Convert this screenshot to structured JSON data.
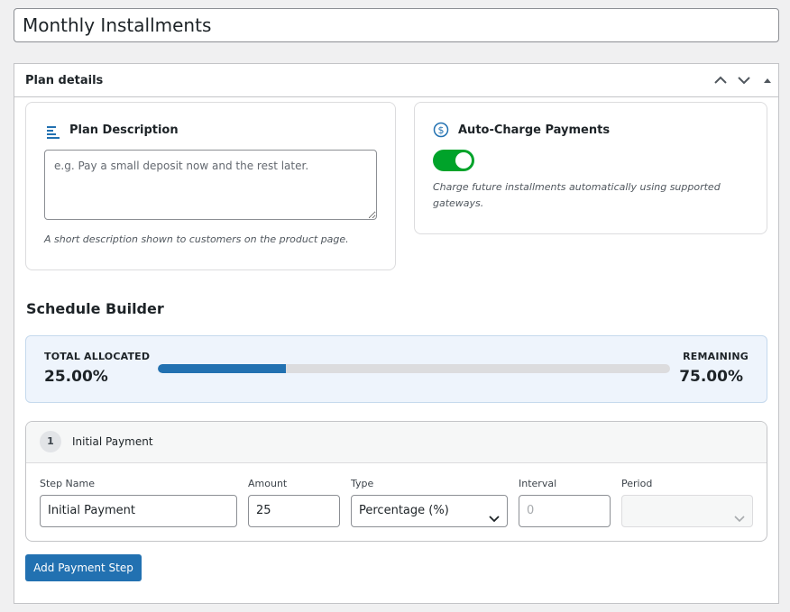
{
  "post_title": "Monthly Installments",
  "metabox": {
    "title": "Plan details",
    "icons": [
      "chevron-up-icon",
      "chevron-down-icon",
      "collapse-triangle-icon"
    ]
  },
  "plan_description": {
    "title": "Plan Description",
    "icon": "text-lines-icon",
    "placeholder": "e.g. Pay a small deposit now and the rest later.",
    "value": "",
    "help": "A short description shown to customers on the product page."
  },
  "auto_charge": {
    "title": "Auto-Charge Payments",
    "icon": "dollar-circle-icon",
    "enabled": true,
    "help": "Charge future installments automatically using supported gateways."
  },
  "schedule": {
    "title": "Schedule Builder",
    "total_label": "TOTAL ALLOCATED",
    "total_value": "25.00%",
    "remaining_label": "REMAINING",
    "remaining_value": "75.00%",
    "allocated_fraction": 0.25,
    "colors": {
      "bar_fill": "#2271b1",
      "toggle_on": "#00a32a"
    }
  },
  "steps": [
    {
      "number": "1",
      "header_name": "Initial Payment",
      "fields": {
        "step_name_label": "Step Name",
        "step_name_value": "Initial Payment",
        "amount_label": "Amount",
        "amount_value": "25",
        "type_label": "Type",
        "type_value": "Percentage (%)",
        "interval_label": "Interval",
        "interval_placeholder": "0",
        "period_label": "Period",
        "period_value": ""
      }
    }
  ],
  "add_step_label": "Add Payment Step"
}
